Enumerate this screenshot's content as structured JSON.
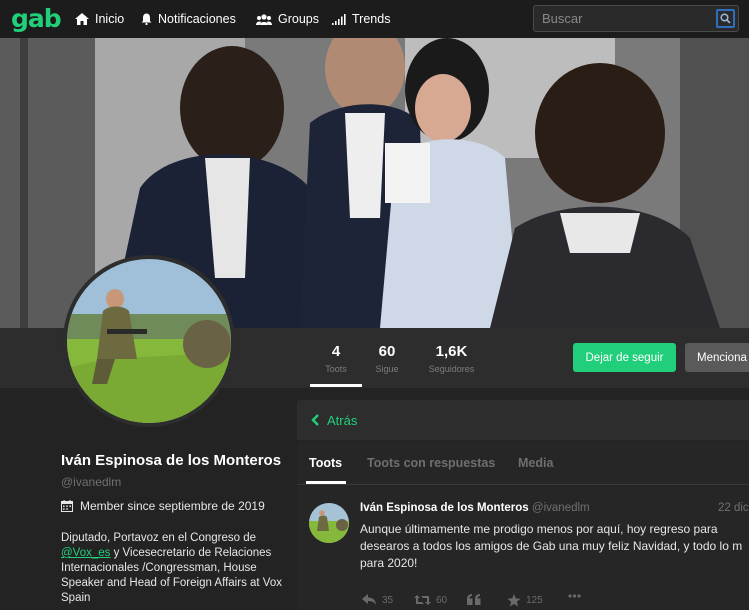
{
  "nav": {
    "logo": "gab",
    "items": [
      {
        "label": "Inicio",
        "icon": "home-icon"
      },
      {
        "label": "Notificaciones",
        "icon": "bell-icon"
      },
      {
        "label": "Groups",
        "icon": "group-icon"
      },
      {
        "label": "Trends",
        "icon": "signal-icon"
      }
    ],
    "search_placeholder": "Buscar"
  },
  "stats": [
    {
      "value": "4",
      "label": "Toots"
    },
    {
      "value": "60",
      "label": "Sigue"
    },
    {
      "value": "1,6K",
      "label": "Seguidores"
    }
  ],
  "actions": {
    "unfollow": "Dejar de seguir",
    "mention": "Menciona"
  },
  "profile": {
    "name": "Iván Espinosa de los Monteros",
    "handle": "@ivanedlm",
    "member_since": "Member since septiembre de 2019",
    "bio_before": "Diputado, Portavoz en el Congreso de ",
    "bio_link": "@Vox_es",
    "bio_after": " y Vicesecretario de Relaciones Internacionales /Congressman, House Speaker and Head of Foreign Affairs at Vox Spain"
  },
  "timeline": {
    "back": "Atrás",
    "tabs": [
      "Toots",
      "Toots con respuestas",
      "Media"
    ]
  },
  "post": {
    "author": "Iván Espinosa de los Monteros",
    "handle": "@ivanedlm",
    "date": "22 dic",
    "lines": [
      "Aunque últimamente me prodigo menos por aquí, hoy regreso para",
      "desearos a todos los amigos de Gab una muy feliz Navidad, y todo lo m",
      "para 2020!"
    ],
    "replies": "35",
    "reposts": "60",
    "favourites": "125"
  },
  "colors": {
    "accent": "#21cf7a",
    "background": "#232323"
  }
}
